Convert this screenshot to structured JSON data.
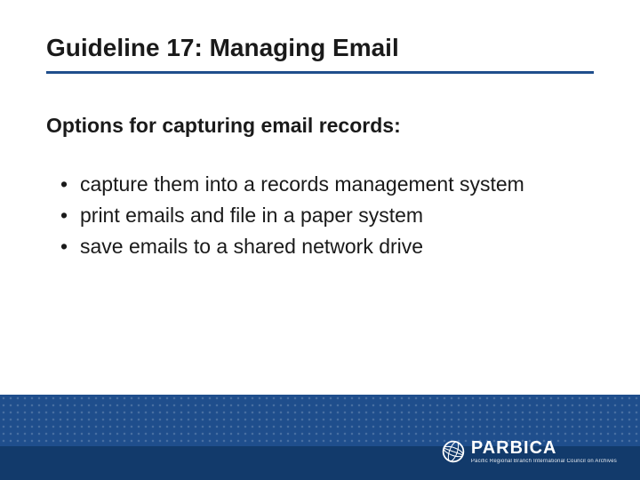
{
  "title": "Guideline 17: Managing Email",
  "subtitle": "Options for capturing email records:",
  "bullets": [
    "capture them into a records management system",
    "print emails and file in a paper system",
    "save emails to a shared network drive"
  ],
  "footer": {
    "logo_name": "PARBICA",
    "logo_tagline": "Pacific Regional Branch International Council on Archives"
  }
}
